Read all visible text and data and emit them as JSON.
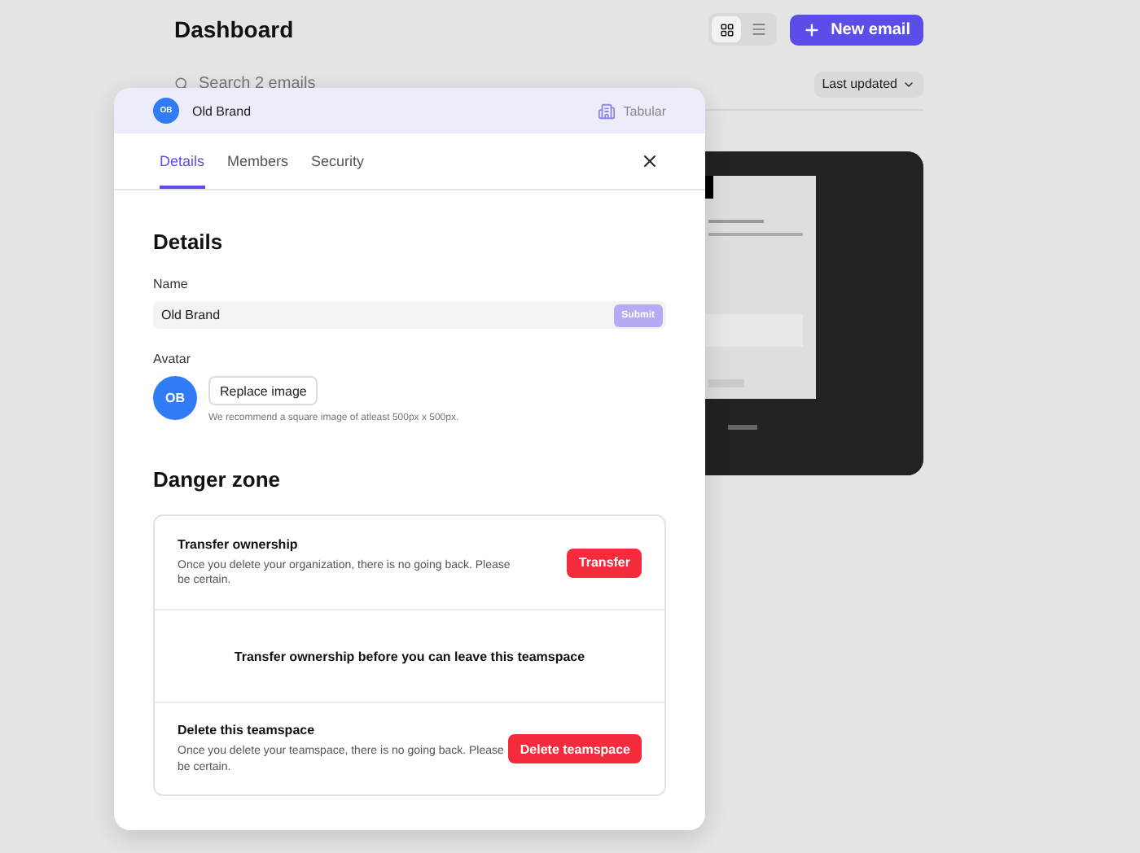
{
  "page": {
    "title": "Dashboard",
    "view_toggle": [
      {
        "kind": "grid",
        "selected": true
      },
      {
        "kind": "list",
        "selected": false
      }
    ],
    "new_button": "New email",
    "search": {
      "placeholder": "Search 2 emails"
    },
    "sort": "Last updated"
  },
  "modal": {
    "team": {
      "initials": "OB",
      "name": "Old Brand"
    },
    "workspace": "Tabular",
    "tabs": [
      {
        "label": "Details",
        "selected": true
      },
      {
        "label": "Members",
        "selected": false
      },
      {
        "label": "Security",
        "selected": false
      }
    ],
    "heading": "Details",
    "name_label": "Name",
    "name_value": "Old Brand",
    "submit": {
      "label": "Submit",
      "disabled": true
    },
    "avatar_label": "Avatar",
    "avatar_initials": "OB",
    "replace_button": "Replace image",
    "avatar_hint": "We recommend a square image of atleast 500px x 500px.",
    "danger_heading": "Danger zone",
    "danger_items": [
      {
        "title": "Transfer ownership",
        "description": "Once you delete your organization, there is no going back. Please be certain.",
        "button": "Transfer",
        "disabled": false
      },
      {
        "disabled": true,
        "notice": "Transfer ownership before you can leave this teamspace"
      },
      {
        "title": "Delete this teamspace",
        "description": "Once you delete your teamspace, there is no going back. Please be certain.",
        "button": "Delete teamspace",
        "disabled": false
      }
    ]
  }
}
